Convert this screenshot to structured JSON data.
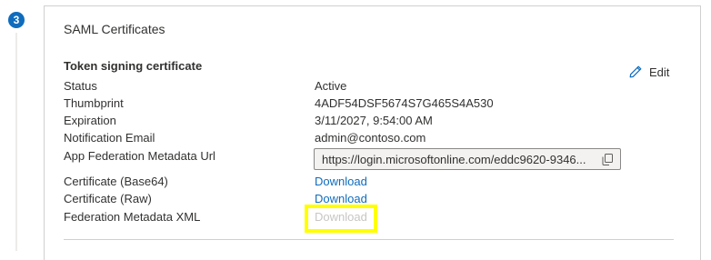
{
  "step": {
    "number": "3"
  },
  "card": {
    "title": "SAML Certificates",
    "edit_label": "Edit"
  },
  "token_signing": {
    "heading": "Token signing certificate",
    "rows": [
      {
        "label": "Status",
        "value": "Active"
      },
      {
        "label": "Thumbprint",
        "value": "4ADF54DSF5674S7G465S4A530"
      },
      {
        "label": "Expiration",
        "value": "3/11/2027, 9:54:00 AM"
      },
      {
        "label": "Notification Email",
        "value": "admin@contoso.com"
      }
    ],
    "metadata_url": {
      "label": "App Federation Metadata Url",
      "value": "https://login.microsoftonline.com/eddc9620-9346..."
    },
    "downloads": [
      {
        "label": "Certificate (Base64)",
        "link": "Download",
        "enabled": true
      },
      {
        "label": "Certificate (Raw)",
        "link": "Download",
        "enabled": true
      },
      {
        "label": "Federation Metadata XML",
        "link": "Download",
        "enabled": false
      }
    ]
  },
  "colors": {
    "accent": "#0f6cbd",
    "highlight": "#ffff00",
    "disabled": "#c8c6c4"
  },
  "icons": {
    "edit": "pencil-icon",
    "copy": "copy-icon"
  }
}
